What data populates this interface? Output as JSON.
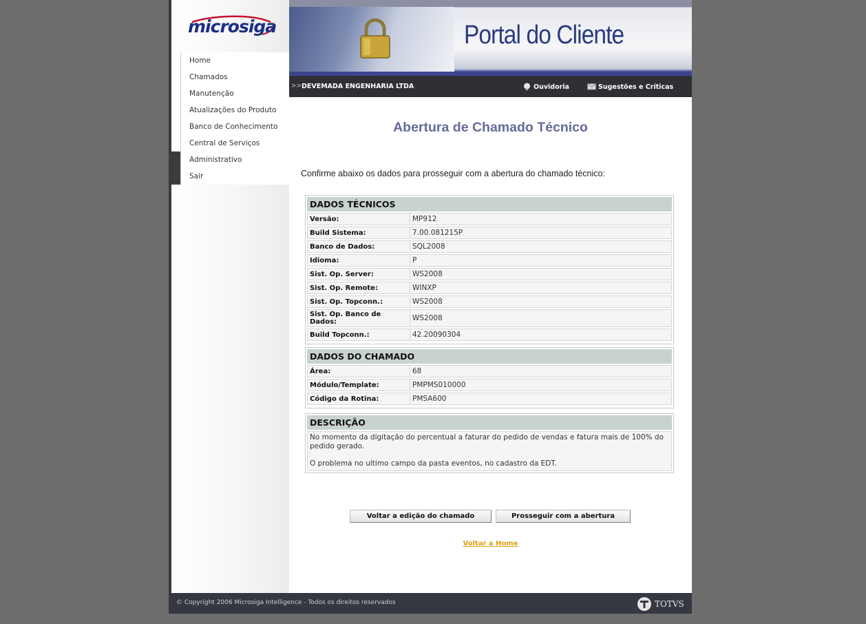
{
  "header": {
    "brand": "microsiga",
    "banner_title": "Portal do Cliente",
    "company": "DEVEMADA ENGENHARIA LTDA",
    "ouvidoria": "Ouvidoria",
    "sugestoes": "Sugestões e Críticas"
  },
  "menu": {
    "items": [
      {
        "label": "Home"
      },
      {
        "label": "Chamados"
      },
      {
        "label": "Manutenção"
      },
      {
        "label": "Atualizações do Produto"
      },
      {
        "label": "Banco de Conhecimento"
      },
      {
        "label": "Central de Serviços"
      },
      {
        "label": "Administrativo"
      },
      {
        "label": "Sair"
      }
    ]
  },
  "main": {
    "title": "Abertura de Chamado Técnico",
    "intro": "Confirme abaixo os dados para prosseguir com a abertura do chamado técnico:",
    "dados_tecnicos": {
      "header": "DADOS TÉCNICOS",
      "rows": [
        {
          "label": "Versão:",
          "value": "MP912"
        },
        {
          "label": "Build Sistema:",
          "value": "7.00.081215P"
        },
        {
          "label": "Banco de Dados:",
          "value": "SQL2008"
        },
        {
          "label": "Idioma:",
          "value": "P"
        },
        {
          "label": "Sist. Op. Server:",
          "value": "WS2008"
        },
        {
          "label": "Sist. Op. Remote:",
          "value": "WINXP"
        },
        {
          "label": "Sist. Op. Topconn.:",
          "value": "WS2008"
        },
        {
          "label": "Sist. Op. Banco de Dados:",
          "value": "WS2008"
        },
        {
          "label": "Build Topconn.:",
          "value": "42.20090304"
        }
      ]
    },
    "dados_chamado": {
      "header": "DADOS DO CHAMADO",
      "rows": [
        {
          "label": "Área:",
          "value": "68"
        },
        {
          "label": "Módulo/Template:",
          "value": "PMPMS010000"
        },
        {
          "label": "Código da Rotina:",
          "value": "PMSA600"
        }
      ]
    },
    "descricao": {
      "header": "DESCRIÇÃO",
      "paragraph1": "No momento da digitação do percentual a faturar do pedido de vendas e fatura mais de 100% do pedido gerado.",
      "paragraph2": "O problema no ultimo campo da pasta eventos, no cadastro da EDT."
    },
    "buttons": {
      "back": "Voltar a edição do chamado",
      "proceed": "Prosseguir com a abertura"
    },
    "home_link": "Voltar a Home"
  },
  "footer": {
    "copyright": "© Copyright 2006 Microsiga Intelligence - Todos os direitos reservados",
    "brand": "TOTVS"
  },
  "colors": {
    "background": "#6d6d6d",
    "title": "#666a9a",
    "section_header": "#c8d3cd",
    "link": "#e0a016",
    "dark_bar": "#2e3035"
  }
}
